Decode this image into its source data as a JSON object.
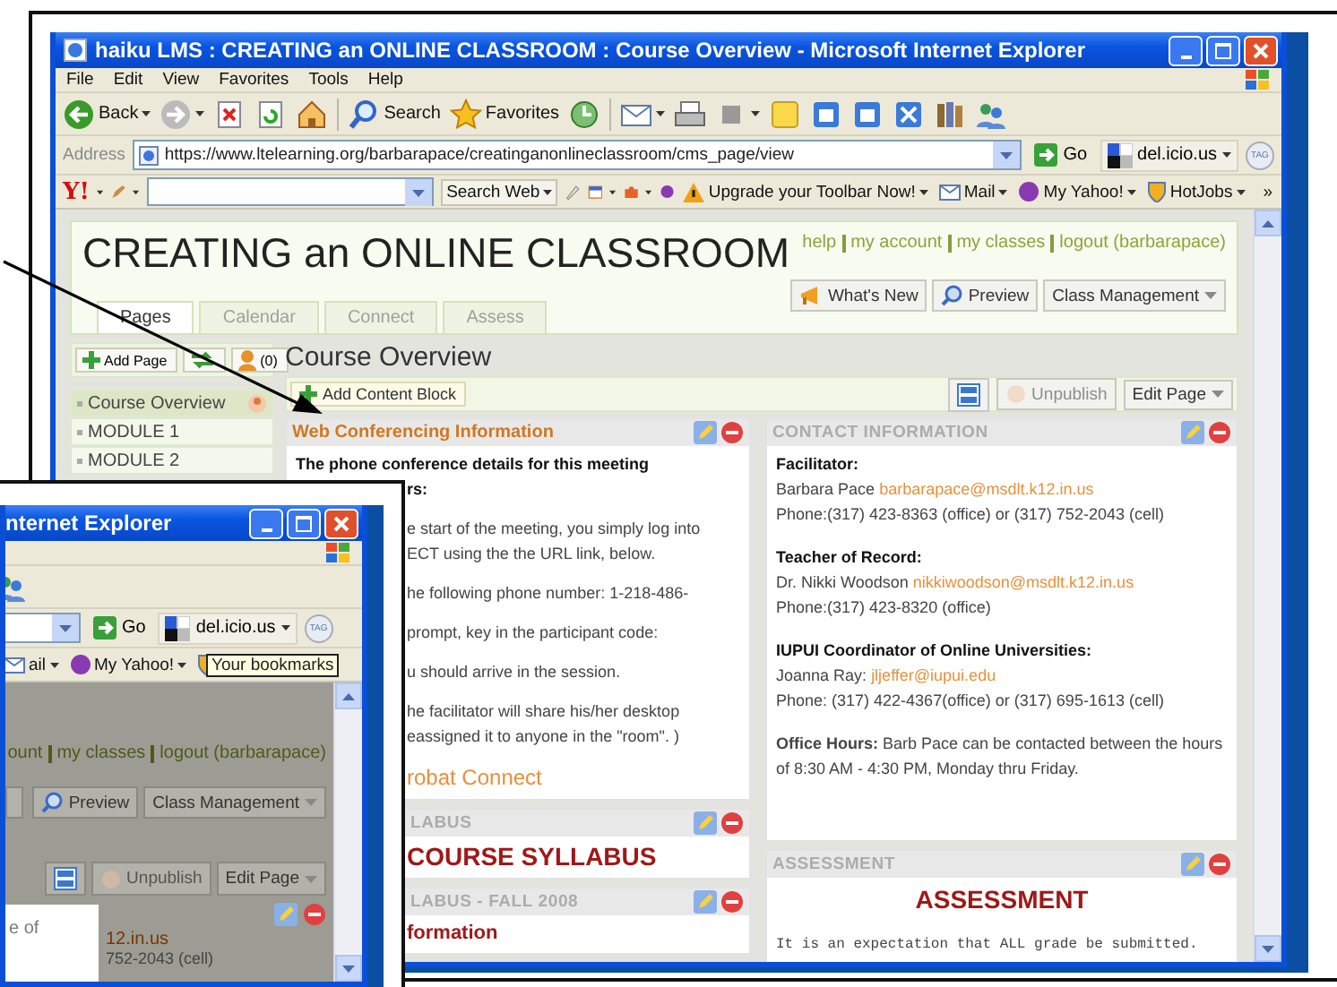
{
  "main_window": {
    "title": "haiku LMS : CREATING an ONLINE CLASSROOM : Course Overview - Microsoft Internet Explorer",
    "menu": [
      "File",
      "Edit",
      "View",
      "Favorites",
      "Tools",
      "Help"
    ],
    "toolbar": [
      {
        "kind": "back",
        "label": "Back"
      },
      {
        "kind": "forward"
      },
      {
        "kind": "stop"
      },
      {
        "kind": "refresh"
      },
      {
        "kind": "home"
      },
      {
        "kind": "separator"
      },
      {
        "kind": "search",
        "label": "Search"
      },
      {
        "kind": "favorites",
        "label": "Favorites"
      },
      {
        "kind": "history"
      },
      {
        "kind": "separator"
      },
      {
        "kind": "mail"
      },
      {
        "kind": "print"
      },
      {
        "kind": "edit"
      },
      {
        "kind": "note"
      },
      {
        "kind": "app"
      },
      {
        "kind": "app"
      },
      {
        "kind": "crossed"
      },
      {
        "kind": "books"
      },
      {
        "kind": "people"
      }
    ],
    "address": {
      "label": "Address",
      "url": "https://www.ltelearning.org/barbarapace/creatinganonlineclassroom/cms_page/view",
      "go": "Go",
      "bookmarks": "del.icio.us",
      "tag": "TAG"
    },
    "yahoo_bar": {
      "logo": "Y!",
      "search_button": "Search Web",
      "items": [
        {
          "kind": "alert",
          "label": "Upgrade your Toolbar Now!"
        },
        {
          "kind": "mail",
          "label": "Mail"
        },
        {
          "kind": "myyahoo",
          "label": "My Yahoo!"
        },
        {
          "kind": "hotjobs",
          "label": "HotJobs"
        }
      ],
      "more": "»"
    },
    "page": {
      "title": "CREATING an ONLINE CLASSROOM",
      "user_links": [
        "help",
        "my account",
        "my classes",
        "logout (barbarapace)"
      ],
      "tabs": [
        {
          "label": "Pages",
          "selected": true
        },
        {
          "label": "Calendar",
          "selected": false
        },
        {
          "label": "Connect",
          "selected": false
        },
        {
          "label": "Assess",
          "selected": false
        }
      ],
      "header_buttons": [
        {
          "kind": "megaphone",
          "label": "What's New"
        },
        {
          "kind": "preview",
          "label": "Preview"
        },
        {
          "kind": "dropdown",
          "label": "Class Management"
        }
      ],
      "sidebar": {
        "buttons": [
          {
            "kind": "add",
            "label": "Add Page"
          },
          {
            "kind": "reorder"
          },
          {
            "kind": "people",
            "label": "(0)"
          }
        ],
        "items": [
          {
            "label": "Course Overview",
            "selected": true
          },
          {
            "label": "MODULE 1",
            "selected": false
          },
          {
            "label": "MODULE 2",
            "selected": false
          }
        ]
      },
      "heading": "Course Overview",
      "add_block": "Add Content Block",
      "page_buttons": [
        {
          "kind": "layout"
        },
        {
          "kind": "unpublish",
          "label": "Unpublish",
          "disabled": true
        },
        {
          "kind": "dropdown",
          "label": "Edit Page",
          "disabled": false
        }
      ],
      "columns": [
        [
          {
            "title": "Web Conferencing Information",
            "active": true,
            "covered": false,
            "body": [
              {
                "lines": [
                  {
                    "kind": "bold",
                    "text": "The phone conference details for this meeting",
                    "covered": false
                  },
                  {
                    "kind": "bold",
                    "text": "rs:",
                    "covered": true
                  }
                ]
              },
              {
                "lines": [
                  {
                    "kind": "text",
                    "text": "e start of the meeting, you simply log into",
                    "covered": true
                  },
                  {
                    "kind": "text",
                    "text": "ECT using the the URL link, below.",
                    "covered": true
                  }
                ]
              },
              {
                "lines": [
                  {
                    "kind": "text",
                    "text": "he following phone number: 1-218-486-",
                    "covered": true
                  }
                ]
              },
              {
                "lines": [
                  {
                    "kind": "text",
                    "text": "prompt, key in the participant code:",
                    "covered": true
                  }
                ]
              },
              {
                "lines": [
                  {
                    "kind": "text",
                    "text": "u should arrive in the session.",
                    "covered": true
                  }
                ]
              },
              {
                "lines": [
                  {
                    "kind": "text",
                    "text": "he facilitator will share his/her desktop",
                    "covered": true
                  },
                  {
                    "kind": "text",
                    "text": "eassigned it to anyone in the \"room\". )",
                    "covered": true
                  }
                ]
              },
              {
                "lines": [
                  {
                    "kind": "link",
                    "text": "robat Connect",
                    "covered": true
                  }
                ]
              }
            ]
          },
          {
            "title": "LABUS",
            "active": false,
            "covered": true,
            "body": [
              {
                "lines": [
                  {
                    "kind": "heading",
                    "text": "COURSE SYLLABUS",
                    "covered": true
                  }
                ]
              }
            ]
          },
          {
            "title": "LABUS - FALL 2008",
            "active": false,
            "covered": true,
            "body": [
              {
                "lines": [
                  {
                    "kind": "subheading",
                    "text": "formation",
                    "covered": true
                  }
                ]
              }
            ]
          }
        ],
        [
          {
            "title": "CONTACT INFORMATION",
            "active": false,
            "covered": false,
            "body": [
              {
                "lines": [
                  {
                    "kind": "bold",
                    "text": "Facilitator:",
                    "covered": false
                  },
                  {
                    "kind": "text",
                    "text": "Barbara Pace",
                    "link": "barbarapace@msdlt.k12.in.us",
                    "covered": false
                  },
                  {
                    "kind": "text",
                    "text": "Phone:(317) 423-8363 (office) or (317) 752-2043 (cell)",
                    "covered": false
                  }
                ]
              },
              {
                "lines": [
                  {
                    "kind": "bold",
                    "text": "Teacher of Record:",
                    "covered": false
                  },
                  {
                    "kind": "text",
                    "text": "Dr. Nikki Woodson",
                    "link": "nikkiwoodson@msdlt.k12.in.us",
                    "covered": false
                  },
                  {
                    "kind": "text",
                    "text": "Phone:(317) 423-8320 (office)",
                    "covered": false
                  }
                ]
              },
              {
                "lines": [
                  {
                    "kind": "bold",
                    "text": "IUPUI Coordinator of Online Universities:",
                    "covered": false
                  },
                  {
                    "kind": "text",
                    "text": "Joanna Ray:",
                    "link": "jljeffer@iupui.edu",
                    "covered": false
                  },
                  {
                    "kind": "text",
                    "text": "Phone: (317) 422-4367(office)  or (317) 695-1613 (cell)",
                    "covered": false
                  }
                ]
              },
              {
                "lines": [
                  {
                    "kind": "text",
                    "text": "**Office Hours:** Barb Pace can be contacted between the hours of 8:30 AM - 4:30 PM, Monday thru Friday.",
                    "covered": false
                  }
                ]
              }
            ]
          },
          {
            "title": "ASSESSMENT",
            "active": false,
            "covered": false,
            "body": [
              {
                "lines": [
                  {
                    "kind": "title",
                    "text": "ASSESSMENT",
                    "covered": false
                  }
                ]
              },
              {
                "lines": [
                  {
                    "kind": "mono",
                    "text": "It is an expectation that ALL grade be submitted.",
                    "covered": false
                  }
                ]
              }
            ]
          }
        ]
      ]
    }
  },
  "front_window": {
    "title": "nternet Explorer",
    "toolbar": [
      {
        "kind": "people"
      }
    ],
    "address": {
      "go": "Go",
      "bookmarks": "del.icio.us",
      "tag": "TAG"
    },
    "yahoo_items": [
      {
        "kind": "mail",
        "label": "ail"
      },
      {
        "kind": "myyahoo",
        "label": "My Yahoo!"
      },
      {
        "kind": "hotjobs"
      }
    ],
    "tooltip": "Your bookmarks",
    "page": {
      "user_links": [
        "ount",
        "my classes",
        "logout (barbarapace)"
      ],
      "header_buttons": [
        {
          "kind": "blank"
        },
        {
          "kind": "preview",
          "label": "Preview"
        },
        {
          "kind": "dropdown",
          "label": "Class Management"
        }
      ],
      "page_buttons": [
        {
          "kind": "layout"
        },
        {
          "kind": "unpublish",
          "label": "Unpublish",
          "disabled": true
        },
        {
          "kind": "dropdown",
          "label": "Edit Page",
          "disabled": false
        }
      ],
      "popup_text": "e of",
      "contact_lines": [
        {
          "kind": "link",
          "text": "12.in.us"
        },
        {
          "kind": "text",
          "text": "752-2043 (cell)"
        }
      ]
    }
  }
}
